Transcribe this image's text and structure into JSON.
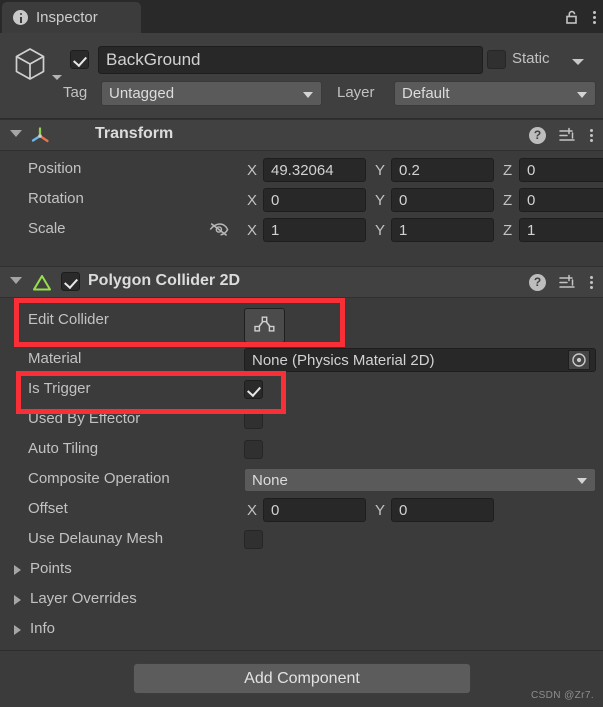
{
  "window": {
    "tab_label": "Inspector",
    "tab_icon": "info-icon",
    "lock_icon": "unlocked-padlock-icon",
    "menu_icon": "kebab-menu-icon"
  },
  "object_header": {
    "icon": "cube-icon",
    "enabled": true,
    "name_value": "BackGround",
    "static_label": "Static",
    "static_checked": false,
    "tag_label": "Tag",
    "tag_value": "Untagged",
    "layer_label": "Layer",
    "layer_value": "Default"
  },
  "transform": {
    "title": "Transform",
    "icon": "transform-axis-icon",
    "help_icon": "help-icon",
    "preset_icon": "preset-settings-icon",
    "menu_icon": "kebab-menu-icon",
    "rows": [
      {
        "label": "Position",
        "x": "49.32064",
        "y": "0.2",
        "z": "0"
      },
      {
        "label": "Rotation",
        "x": "0",
        "y": "0",
        "z": "0"
      },
      {
        "label": "Scale",
        "x": "1",
        "y": "1",
        "z": "1"
      }
    ],
    "axis_labels": [
      "X",
      "Y",
      "Z"
    ],
    "scale_constrain_icon": "eye-slash-icon"
  },
  "collider": {
    "title": "Polygon Collider 2D",
    "icon": "green-triangle-icon",
    "enabled": true,
    "help_icon": "help-icon",
    "preset_icon": "preset-settings-icon",
    "menu_icon": "kebab-menu-icon",
    "edit_collider_label": "Edit Collider",
    "edit_collider_icon": "edit-polygon-icon",
    "material_label": "Material",
    "material_value": "None (Physics Material 2D)",
    "material_picker_icon": "object-picker-icon",
    "is_trigger_label": "Is Trigger",
    "is_trigger_checked": true,
    "used_by_effector_label": "Used By Effector",
    "used_by_effector_checked": false,
    "auto_tiling_label": "Auto Tiling",
    "auto_tiling_checked": false,
    "composite_operation_label": "Composite Operation",
    "composite_operation_value": "None",
    "offset_label": "Offset",
    "offset_x": "0",
    "offset_y": "0",
    "offset_axis_labels": [
      "X",
      "Y"
    ],
    "use_delaunay_label": "Use Delaunay Mesh",
    "use_delaunay_checked": false,
    "foldouts": [
      {
        "label": "Points"
      },
      {
        "label": "Layer Overrides"
      },
      {
        "label": "Info"
      }
    ]
  },
  "footer": {
    "add_component_label": "Add Component",
    "watermark": "CSDN @Zr7."
  },
  "colors": {
    "highlight": "#f92f37",
    "panel_bg": "#3b3b3b",
    "header_bg": "#414141",
    "collider_accent": "#96e04a"
  }
}
